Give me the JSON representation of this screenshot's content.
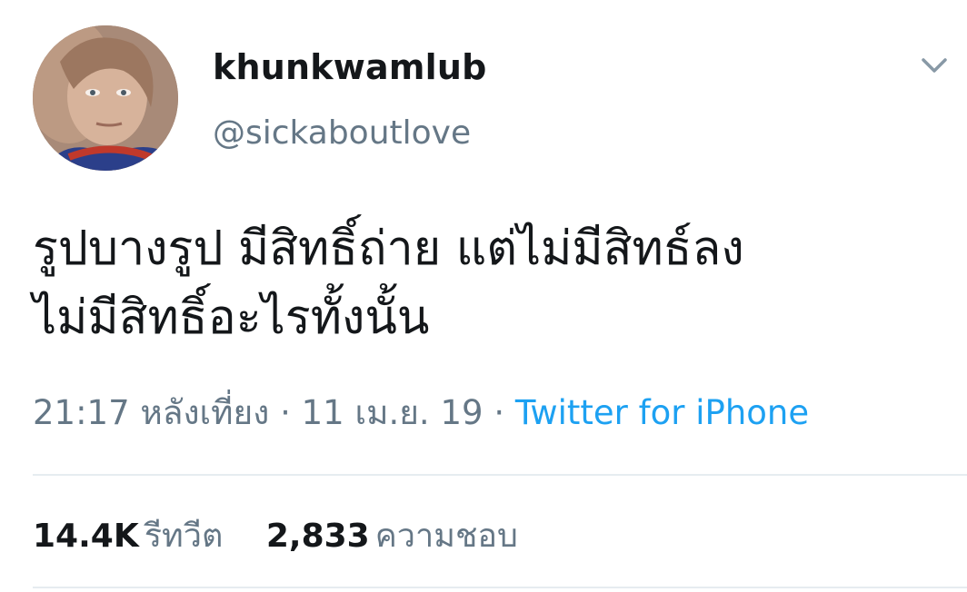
{
  "tweet": {
    "author": {
      "display_name": "khunkwamlub",
      "handle": "@sickaboutlove"
    },
    "text_lines": [
      "รูปบางรูป มีสิทธิ์ถ่าย แต่ไม่มีสิทธ์ลง",
      "ไม่มีสิทธิ์อะไรทั้งนั้น"
    ],
    "time": "21:17 หลังเที่ยง",
    "date": "11 เม.ย. 19",
    "separator": "·",
    "source": "Twitter for iPhone",
    "stats": {
      "retweets_count": "14.4K",
      "retweets_label": "รีทวีต",
      "likes_count": "2,833",
      "likes_label": "ความชอบ"
    }
  },
  "icons": {
    "menu": "chevron-down-icon"
  },
  "colors": {
    "text": "#14171a",
    "secondary": "#657786",
    "link": "#1da1f2",
    "divider": "#e6ecf0"
  }
}
